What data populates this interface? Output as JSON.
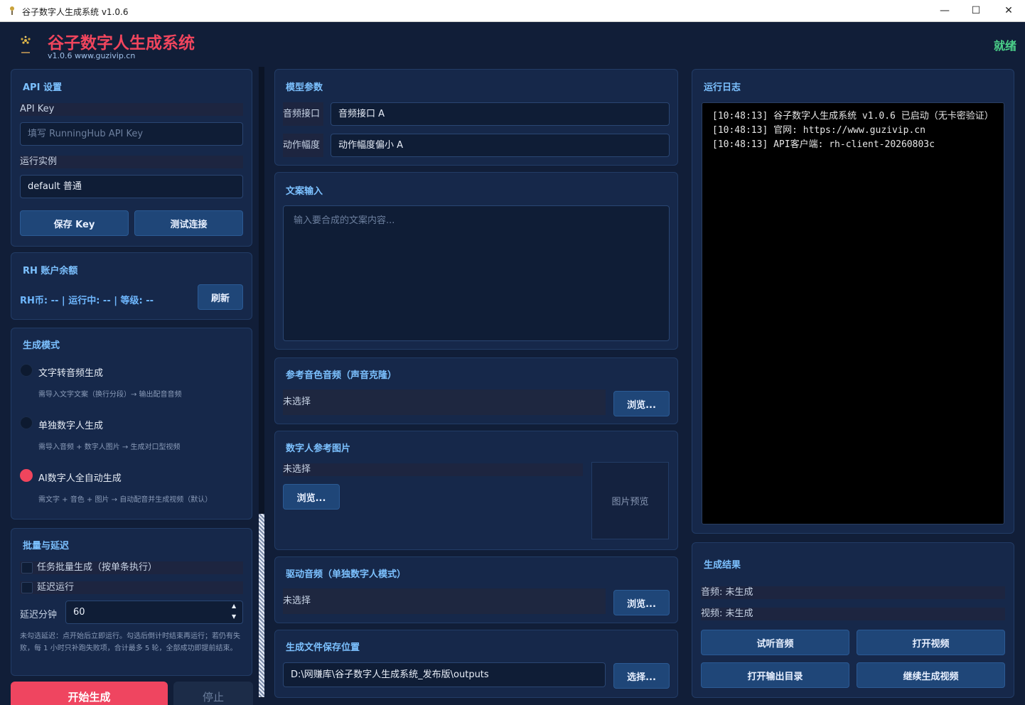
{
  "window": {
    "title": "谷子数字人生成系统 v1.0.6",
    "minimize": "—",
    "maximize": "☐",
    "close": "✕"
  },
  "header": {
    "title": "谷子数字人生成系统",
    "subtitle": "v1.0.6  www.guzivip.cn",
    "status": "就绪"
  },
  "api": {
    "title": "API 设置",
    "key_label": "API Key",
    "key_placeholder": "填写 RunningHub API Key",
    "instance_label": "运行实例",
    "instance_value": "default 普通",
    "save_label": "保存 Key",
    "test_label": "测试连接"
  },
  "balance": {
    "title": "RH 账户余额",
    "info": "RH币: -- | 运行中: -- | 等级: --",
    "refresh_label": "刷新"
  },
  "mode": {
    "title": "生成模式",
    "options": [
      {
        "label": "文字转音频生成",
        "desc": "需导入文字文案（换行分段）→ 输出配音音频",
        "selected": false
      },
      {
        "label": "单独数字人生成",
        "desc": "需导入音频 + 数字人图片 → 生成对口型视频",
        "selected": false
      },
      {
        "label": "AI数字人全自动生成",
        "desc": "需文字 + 音色 + 图片 → 自动配音并生成视频（默认）",
        "selected": true
      }
    ]
  },
  "batch": {
    "title": "批量与延迟",
    "batch_label": "任务批量生成（按单条执行）",
    "delay_label": "延迟运行",
    "delay_minutes_label": "延迟分钟",
    "delay_minutes_value": "60",
    "note": "未勾选延迟：点开始后立即运行。勾选后倒计时结束再运行；若仍有失败，每 1 小时只补跑失败项，合计最多 5 轮，全部成功即提前结束。"
  },
  "actions": {
    "start_label": "开始生成",
    "stop_label": "停止"
  },
  "model": {
    "title": "模型参数",
    "audio_port_label": "音频接口",
    "audio_port_value": "音频接口 A",
    "motion_label": "动作幅度",
    "motion_value": "动作幅度偏小 A"
  },
  "script": {
    "title": "文案输入",
    "placeholder": "输入要合成的文案内容..."
  },
  "ref_audio": {
    "title": "参考音色音频（声音克隆）",
    "value": "未选择",
    "browse_label": "浏览..."
  },
  "ref_image": {
    "title": "数字人参考图片",
    "value": "未选择",
    "browse_label": "浏览...",
    "preview_label": "图片预览"
  },
  "drive_audio": {
    "title": "驱动音频（单独数字人模式）",
    "value": "未选择",
    "browse_label": "浏览..."
  },
  "output": {
    "title": "生成文件保存位置",
    "path": "D:\\网赚库\\谷子数字人生成系统_发布版\\outputs",
    "choose_label": "选择..."
  },
  "log": {
    "title": "运行日志",
    "lines": [
      "[10:48:13] 谷子数字人生成系统 v1.0.6 已启动（无卡密验证）",
      "[10:48:13] 官网: https://www.guzivip.cn",
      "[10:48:13] API客户端: rh-client-20260803c"
    ]
  },
  "result": {
    "title": "生成结果",
    "audio_status": "音频: 未生成",
    "video_status": "视频: 未生成",
    "listen_label": "试听音频",
    "open_video_label": "打开视频",
    "open_dir_label": "打开输出目录",
    "continue_label": "继续生成视频"
  },
  "colors": {
    "accent": "#f0455d",
    "section_title": "#7cc1ff",
    "status_ok": "#4bd18a",
    "button": "#1f4678"
  }
}
